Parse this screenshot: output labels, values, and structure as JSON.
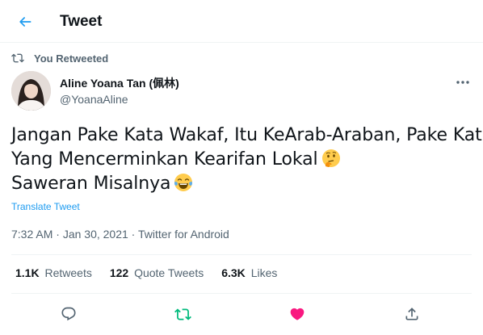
{
  "header": {
    "title": "Tweet",
    "back_icon": "arrow-left-icon"
  },
  "retweet": {
    "label": "You Retweeted",
    "icon": "retweet-icon"
  },
  "author": {
    "display_name": "Aline Yoana Tan (佩林)",
    "handle": "@YoanaAline",
    "avatar": "profile-photo"
  },
  "tweet": {
    "line1": "Jangan Pake Kata Wakaf, Itu KeArab-Araban, Pake Kata",
    "line2": "Yang Mencerminkan Kearifan Lokal",
    "line2_emoji": "thinking-face-emoji",
    "line3": "Saweran Misalnya",
    "line3_emoji": "face-with-tears-of-joy-emoji"
  },
  "translate_label": "Translate Tweet",
  "meta": {
    "time": "7:32 AM",
    "sep1": " · ",
    "date": "Jan 30, 2021",
    "sep2": " · ",
    "source": "Twitter for Android"
  },
  "stats": {
    "retweets_count": "1.1K",
    "retweets_label": "Retweets",
    "quotes_count": "122",
    "quotes_label": "Quote Tweets",
    "likes_count": "6.3K",
    "likes_label": "Likes"
  },
  "actions": [
    "reply-icon",
    "retweet-icon",
    "like-icon",
    "share-icon"
  ],
  "colors": {
    "accent": "#1d9bf0",
    "retweet_active": "#00ba7c",
    "like_active": "#f91880",
    "secondary_text": "#536471",
    "primary_text": "#0f1419",
    "divider": "#eff3f4"
  }
}
